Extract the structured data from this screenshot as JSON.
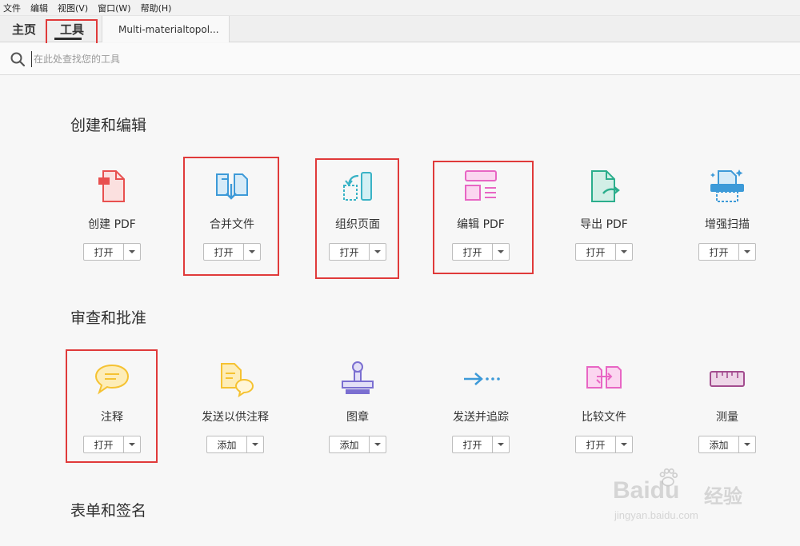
{
  "menu": [
    "文件",
    "编辑",
    "视图(V)",
    "窗口(W)",
    "帮助(H)"
  ],
  "tabs": {
    "home": "主页",
    "tools": "工具",
    "document": "Multi-materialtopol..."
  },
  "search": {
    "placeholder": "在此处查找您的工具"
  },
  "sections": [
    {
      "title": "创建和编辑",
      "tools": [
        {
          "label": "创建 PDF",
          "button": "打开",
          "icon": "create-pdf-icon",
          "color": "#e8504f"
        },
        {
          "label": "合并文件",
          "button": "打开",
          "icon": "combine-files-icon",
          "color": "#3d9ad8"
        },
        {
          "label": "组织页面",
          "button": "打开",
          "icon": "organize-pages-icon",
          "color": "#3ab3c6"
        },
        {
          "label": "编辑 PDF",
          "button": "打开",
          "icon": "edit-pdf-icon",
          "color": "#e866c4"
        },
        {
          "label": "导出 PDF",
          "button": "打开",
          "icon": "export-pdf-icon",
          "color": "#2bae8c"
        },
        {
          "label": "增强扫描",
          "button": "打开",
          "icon": "enhance-scan-icon",
          "color": "#3d9ad8"
        }
      ]
    },
    {
      "title": "审查和批准",
      "tools": [
        {
          "label": "注释",
          "button": "打开",
          "icon": "comment-icon",
          "color": "#f5c232"
        },
        {
          "label": "发送以供注释",
          "button": "添加",
          "icon": "send-for-comments-icon",
          "color": "#f5c232"
        },
        {
          "label": "图章",
          "button": "添加",
          "icon": "stamp-icon",
          "color": "#7b6fd1"
        },
        {
          "label": "发送并追踪",
          "button": "打开",
          "icon": "send-and-track-icon",
          "color": "#3d9ad8"
        },
        {
          "label": "比较文件",
          "button": "打开",
          "icon": "compare-files-icon",
          "color": "#e866c4"
        },
        {
          "label": "测量",
          "button": "添加",
          "icon": "measure-icon",
          "color": "#a34d8f"
        }
      ]
    },
    {
      "title": "表单和签名",
      "tools": []
    }
  ],
  "watermark": {
    "brand": "Baidu",
    "brand_cn": "经验",
    "url": "jingyan.baidu.com"
  }
}
